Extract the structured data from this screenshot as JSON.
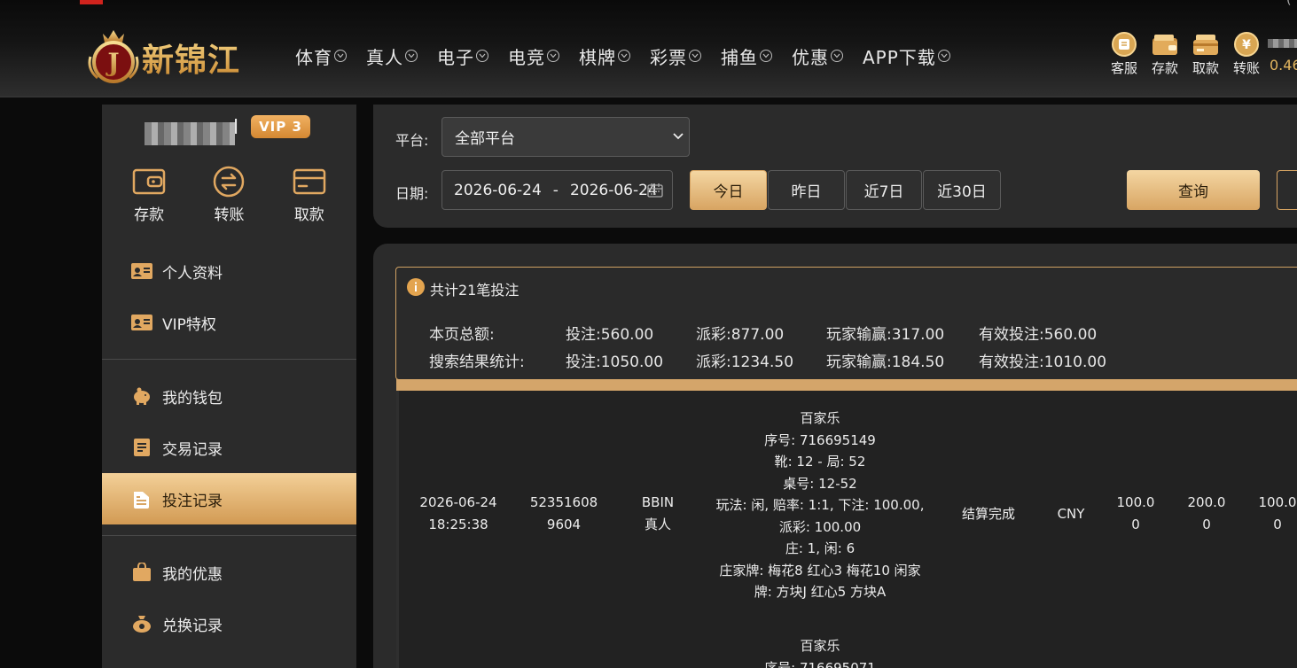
{
  "header": {
    "logo_text": "新锦江",
    "logo_letter": "J",
    "nav": [
      {
        "label": "体育"
      },
      {
        "label": "真人"
      },
      {
        "label": "电子"
      },
      {
        "label": "电竞"
      },
      {
        "label": "棋牌"
      },
      {
        "label": "彩票"
      },
      {
        "label": "捕鱼"
      },
      {
        "label": "优惠"
      },
      {
        "label": "APP下载"
      }
    ],
    "quick": [
      {
        "label": "客服",
        "icon": "customer-service-icon"
      },
      {
        "label": "存款",
        "icon": "wallet-icon"
      },
      {
        "label": "取款",
        "icon": "card-icon"
      },
      {
        "label": "转账",
        "icon": "transfer-coin-icon"
      }
    ],
    "balance": "0.46"
  },
  "sidebar": {
    "username_suffix": "l",
    "vip": "VIP 3",
    "actions": [
      {
        "label": "存款",
        "icon": "wallet-icon"
      },
      {
        "label": "转账",
        "icon": "transfer-icon"
      },
      {
        "label": "取款",
        "icon": "card-icon"
      }
    ],
    "menu_group1": [
      {
        "label": "个人资料",
        "icon": "profile-card-icon"
      },
      {
        "label": "VIP特权",
        "icon": "vip-card-icon"
      }
    ],
    "menu_group2": [
      {
        "label": "我的钱包",
        "icon": "piggy-bank-icon"
      },
      {
        "label": "交易记录",
        "icon": "document-icon"
      },
      {
        "label": "投注记录",
        "icon": "bet-record-icon",
        "active": true
      }
    ],
    "menu_group3": [
      {
        "label": "我的优惠",
        "icon": "gift-bag-icon"
      },
      {
        "label": "兑换记录",
        "icon": "exchange-bag-icon"
      }
    ]
  },
  "filter": {
    "platform_label": "平台:",
    "platform_value": "全部平台",
    "date_label": "日期:",
    "date_start": "2026-06-24",
    "date_sep": "-",
    "date_end": "2026-06-24",
    "quick_ranges": [
      "今日",
      "昨日",
      "近7日",
      "近30日"
    ],
    "search_label": "查询"
  },
  "summary": {
    "title": "共计21笔投注",
    "page_label": "本页总额:",
    "page_bet": "投注:560.00",
    "page_payout": "派彩:877.00",
    "page_winloss": "玩家输赢:317.00",
    "page_valid": "有效投注:560.00",
    "total_label": "搜索结果统计:",
    "total_bet": "投注:1050.00",
    "total_payout": "派彩:1234.50",
    "total_winloss": "玩家输赢:184.50",
    "total_valid": "有效投注:1010.00"
  },
  "rows": [
    {
      "date": "2026-06-24",
      "time": "18:25:38",
      "id_line1": "52351608",
      "id_line2": "9604",
      "platform_line1": "BBIN",
      "platform_line2": "真人",
      "detail": [
        "百家乐",
        "序号: 716695149",
        "靴: 12 - 局: 52",
        "桌号: 12-52",
        "玩法: 闲, 赔率: 1:1, 下注: 100.00,",
        "派彩: 100.00",
        "庄: 1, 闲: 6",
        "庄家牌: 梅花8 红心3 梅花10 闲家",
        "牌: 方块J 红心5 方块A"
      ],
      "status": "结算完成",
      "currency": "CNY",
      "bet_l1": "100.0",
      "bet_l2": "0",
      "payout_l1": "200.0",
      "payout_l2": "0",
      "valid_l1": "100.0",
      "valid_l2": "0"
    },
    {
      "detail": [
        "百家乐",
        "序号: 716695071"
      ]
    }
  ]
}
